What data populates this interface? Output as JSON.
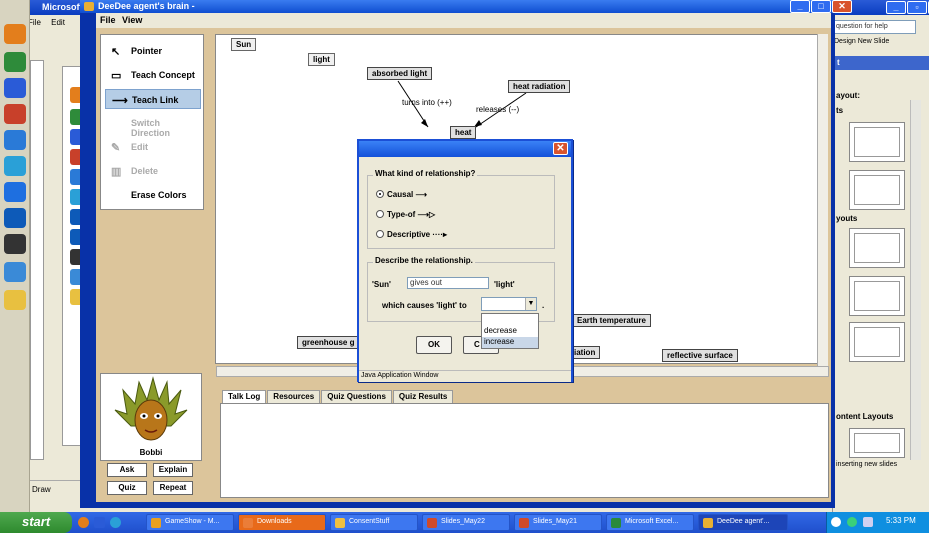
{
  "ppt": {
    "title": "Microsoft P",
    "menu": [
      "File",
      "Edit"
    ],
    "help_placeholder": "question for help",
    "toolbar": "Design  New Slide",
    "pane_head": "t",
    "pane_layout_label": "ayout:",
    "pane_ts_label": "ts",
    "pane_youts": "youts",
    "pane_content": "ontent Layouts",
    "pane_footer": "inserting new slides",
    "draw_label": "Draw"
  },
  "deedee": {
    "title": "DeeDee agent's brain -",
    "menu": [
      "File",
      "View"
    ],
    "tools": [
      {
        "label": "Pointer",
        "icon": "pointer-icon",
        "glyph": "↖"
      },
      {
        "label": "Teach Concept",
        "icon": "concept-icon",
        "glyph": "▭"
      },
      {
        "label": "Teach Link",
        "icon": "link-icon",
        "glyph": "⟶"
      },
      {
        "label": "Switch Direction",
        "icon": "",
        "glyph": ""
      },
      {
        "label": "Edit",
        "icon": "edit-icon",
        "glyph": "✎"
      },
      {
        "label": "Delete",
        "icon": "trash-icon",
        "glyph": "🗑"
      },
      {
        "label": "Erase Colors",
        "icon": "",
        "glyph": ""
      }
    ],
    "nodes": {
      "sun": "Sun",
      "light": "light",
      "absorbed_light": "absorbed light",
      "heat_radiation": "heat radiation",
      "heat": "heat",
      "greenhouse": "greenhouse g",
      "earth_temperature": "Earth temperature",
      "iation": "iation",
      "reflective_surface": "reflective surface"
    },
    "edges": {
      "turns_into": "turns into (++)",
      "releases": "releases (--)"
    },
    "tabs": [
      "Talk Log",
      "Resources",
      "Quiz Questions",
      "Quiz Results"
    ],
    "agent": {
      "name": "Bobbi",
      "buttons": [
        "Ask",
        "Explain",
        "Quiz",
        "Repeat"
      ]
    }
  },
  "dialog": {
    "question": "What kind of relationship?",
    "options": [
      {
        "label": "Causal",
        "arrow": "⟶",
        "selected": true
      },
      {
        "label": "Type-of",
        "arrow": "⟶▷",
        "selected": false
      },
      {
        "label": "Descriptive",
        "arrow": "····▸",
        "selected": false
      }
    ],
    "describe_title": "Describe the relationship.",
    "subject": "'Sun'",
    "verb_value": "gives out",
    "object": "'light'",
    "causes_text": "which causes 'light' to",
    "period": ".",
    "dropdown_options": [
      "decrease",
      "increase"
    ],
    "highlighted_option": "increase",
    "ok_label": "OK",
    "cancel_label": "C",
    "status": "Java Application Window"
  },
  "taskbar": {
    "start": "start",
    "buttons": [
      {
        "label": "GameShow - M...",
        "color": "#e8a020"
      },
      {
        "label": "Downloads",
        "color": "#e86a1a",
        "active": true
      },
      {
        "label": "ConsentStuff",
        "color": "#f0c040"
      },
      {
        "label": "Slides_May22",
        "color": "#d04a2a"
      },
      {
        "label": "Slides_May21",
        "color": "#d04a2a"
      },
      {
        "label": "Microsoft Excel...",
        "color": "#2a8a3a"
      },
      {
        "label": "DeeDee agent'...",
        "color": "#e9b033",
        "active": true
      }
    ],
    "clock": "5:33 PM"
  }
}
